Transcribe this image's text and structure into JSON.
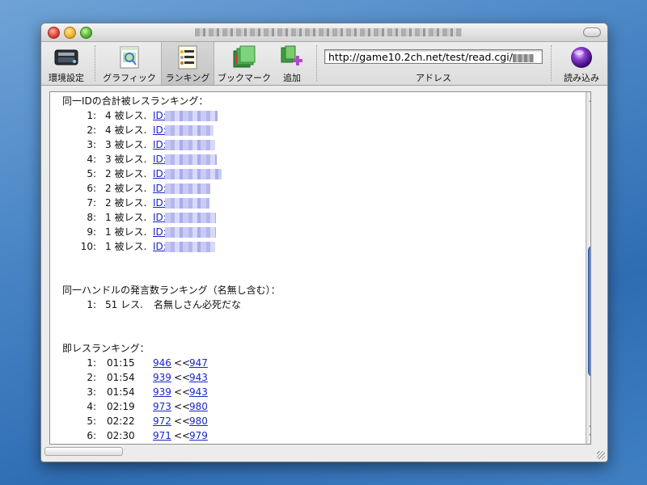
{
  "toolbar": {
    "items": [
      {
        "label": "環境設定"
      },
      {
        "label": "グラフィック"
      },
      {
        "label": "ランキング"
      },
      {
        "label": "ブックマーク"
      },
      {
        "label": "追加"
      },
      {
        "label": "読み込み"
      }
    ],
    "address_value": "http://game10.2ch.net/test/read.cgi/",
    "address_label": "アドレス"
  },
  "sections": {
    "id_ranking": {
      "header": "同一IDの合計被レスランキング：",
      "rows": [
        {
          "rank": "1:",
          "count": "4 被レス.",
          "id": "ID:"
        },
        {
          "rank": "2:",
          "count": "4 被レス.",
          "id": "ID:"
        },
        {
          "rank": "3:",
          "count": "3 被レス.",
          "id": "ID:"
        },
        {
          "rank": "4:",
          "count": "3 被レス.",
          "id": "ID:"
        },
        {
          "rank": "5:",
          "count": "2 被レス.",
          "id": "ID:"
        },
        {
          "rank": "6:",
          "count": "2 被レス.",
          "id": "ID:"
        },
        {
          "rank": "7:",
          "count": "2 被レス.",
          "id": "ID:"
        },
        {
          "rank": "8:",
          "count": "1 被レス.",
          "id": "ID:"
        },
        {
          "rank": "9:",
          "count": "1 被レス.",
          "id": "ID:"
        },
        {
          "rank": "10:",
          "count": "1 被レス.",
          "id": "ID:"
        }
      ]
    },
    "handle_ranking": {
      "header": "同一ハンドルの発言数ランキング（名無し含む）：",
      "rows": [
        {
          "rank": "1:",
          "count": "51 レス.",
          "name": "名無しさん必死だな"
        }
      ]
    },
    "quick_ranking": {
      "header": "即レスランキング：",
      "rows": [
        {
          "rank": "1:",
          "time": "01:15",
          "from": "946",
          "sep": "<<",
          "to": "947"
        },
        {
          "rank": "2:",
          "time": "01:54",
          "from": "939",
          "sep": "<<",
          "to": "943"
        },
        {
          "rank": "3:",
          "time": "01:54",
          "from": "939",
          "sep": "<<",
          "to": "943"
        },
        {
          "rank": "4:",
          "time": "02:19",
          "from": "973",
          "sep": "<<",
          "to": "980"
        },
        {
          "rank": "5:",
          "time": "02:22",
          "from": "972",
          "sep": "<<",
          "to": "980"
        },
        {
          "rank": "6:",
          "time": "02:30",
          "from": "971",
          "sep": "<<",
          "to": "979"
        }
      ]
    }
  },
  "colors": {
    "link": "#1a25c8",
    "scroll_thumb": "#3a6fd0"
  },
  "icons": [
    "preferences-icon",
    "graphic-icon",
    "ranking-icon",
    "bookmark-icon",
    "add-icon",
    "load-icon"
  ]
}
